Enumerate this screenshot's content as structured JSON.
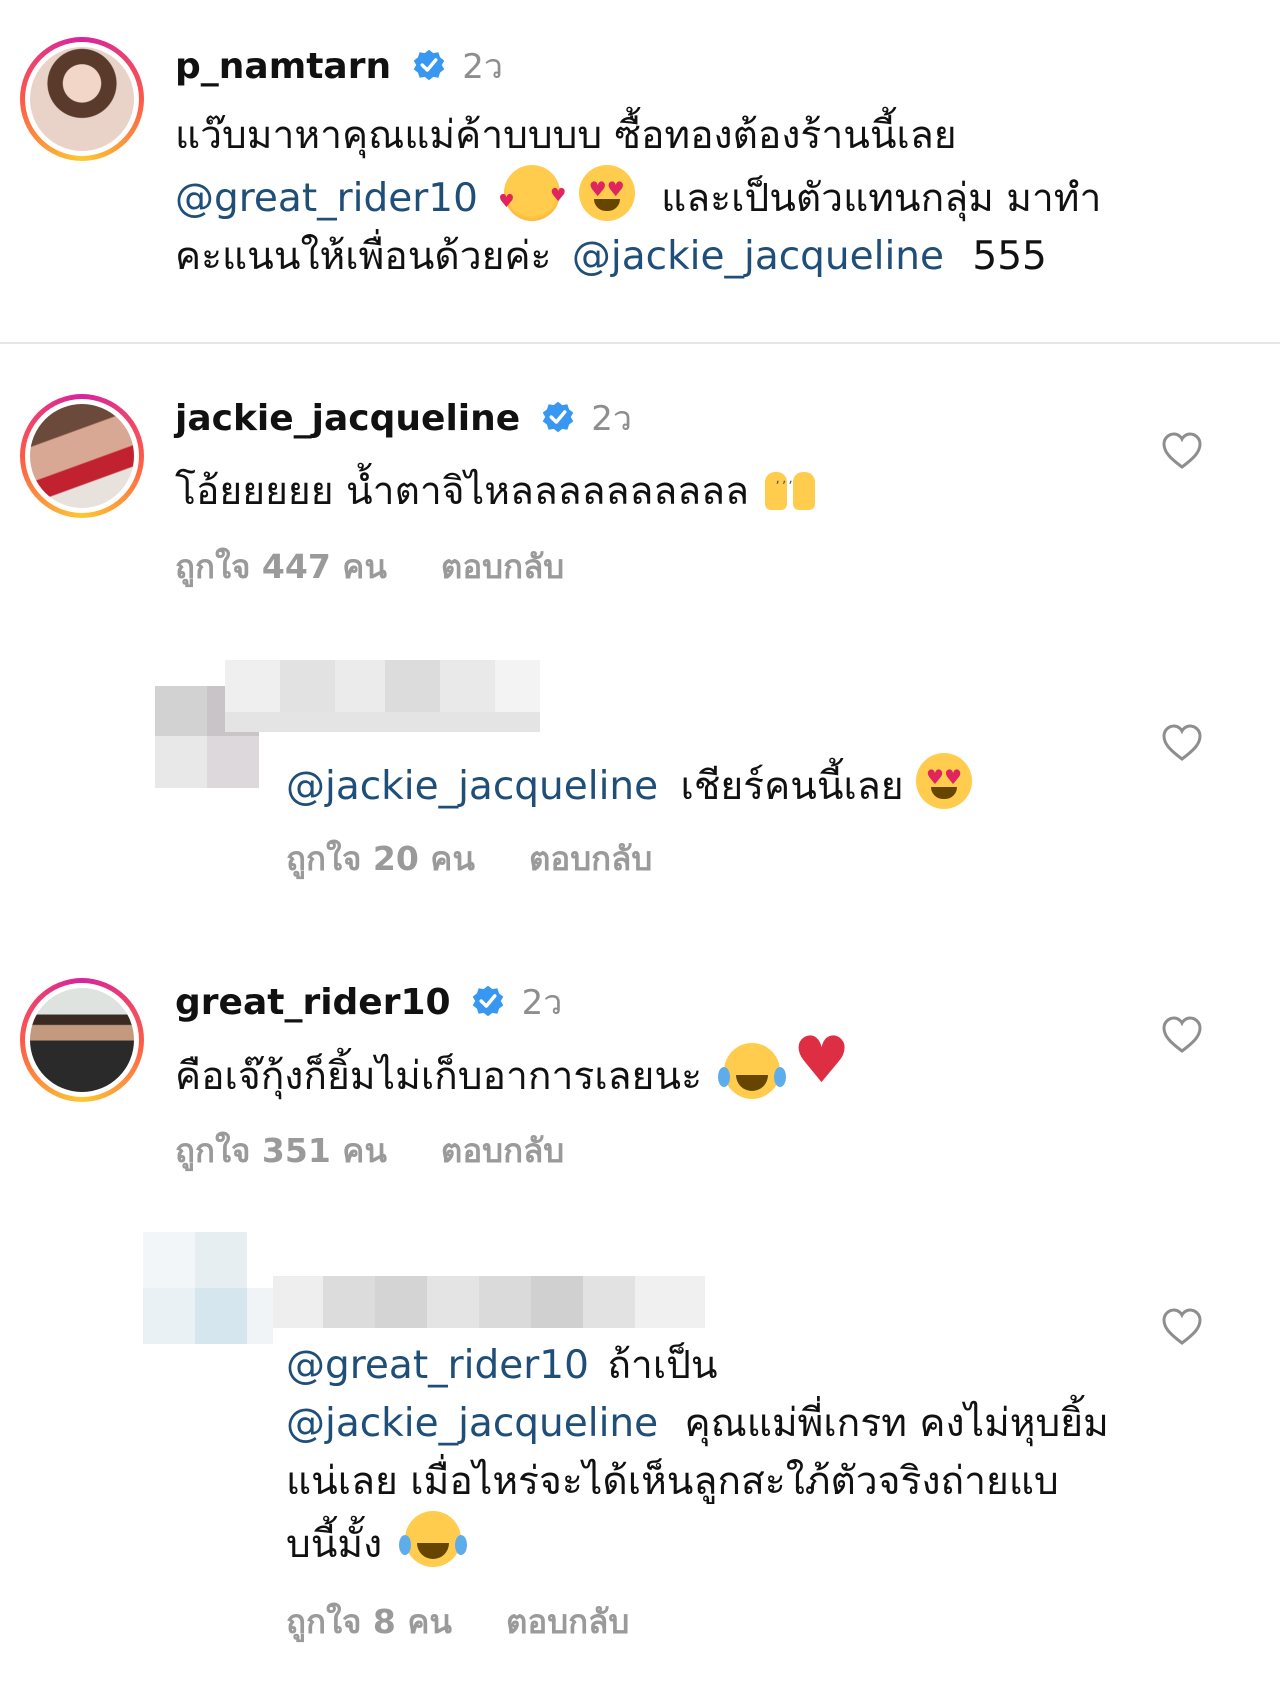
{
  "comments": [
    {
      "username": "p_namtarn",
      "time": "2ว",
      "text_parts": [
        "แว๊บมาหาคุณแม่ค้าบบบบ ซื้อทองต้องร้านนี้เลย",
        "@great_rider10",
        "และเป็นตัวแทนกลุ่ม มาทำคะแนนให้เพื่อนด้วยค่ะ",
        "@jackie_jacqueline",
        "555"
      ],
      "emoji_1": "smiling-hearts-emoji",
      "emoji_2": "heart-eyes-emoji"
    },
    {
      "username": "jackie_jacqueline",
      "time": "2ว",
      "text": "โอ้ยยยยย  น้ำตาจิไหลลลลลลลลลล",
      "emoji": "raising-hands-emoji",
      "likes": "ถูกใจ 447 คน",
      "reply": "ตอบกลับ"
    },
    {
      "username_hidden": true,
      "mention": "@jackie_jacqueline",
      "text": "เชียร์คนนี้เลย",
      "emoji": "heart-eyes-emoji",
      "likes": "ถูกใจ 20 คน",
      "reply": "ตอบกลับ"
    },
    {
      "username": "great_rider10",
      "time": "2ว",
      "text": "คือเจ๊กุ้งก็ยิ้มไม่เก็บอาการเลยนะ",
      "emoji_1": "tears-of-joy-emoji",
      "emoji_2": "red-heart-emoji",
      "likes": "ถูกใจ 351 คน",
      "reply": "ตอบกลับ"
    },
    {
      "username_hidden": true,
      "mention_1": "@great_rider10",
      "text_1": "ถ้าเป็น",
      "mention_2": "@jackie_jacqueline",
      "text_2": "คุณแม่พี่เกรท คงไม่หุบยิ้มแน่เลย เมื่อไหร่จะได้เห็นลูกสะใภ้ตัวจริงถ่ายแบบนี้มั้ง",
      "emoji": "tears-of-joy-emoji",
      "likes": "ถูกใจ 8 คน",
      "reply": "ตอบกลับ"
    }
  ],
  "colors": {
    "mention": "#1f4e79",
    "meta": "#9a9a9a",
    "verified": "#3897f0"
  }
}
